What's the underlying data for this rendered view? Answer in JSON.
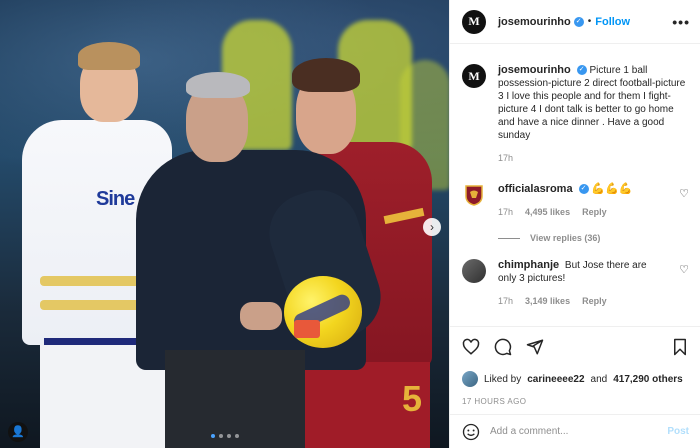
{
  "post": {
    "author": "josemourinho",
    "avatar_letter": "M",
    "follow_label": "Follow",
    "dot": "•",
    "more": "•••",
    "caption": "Picture 1 ball possession-picture 2 direct football-picture 3 I love this people and for them I fight-picture 4 I dont talk is better to go home and have a nice dinner . Have a good sunday",
    "caption_time": "17h",
    "photo": {
      "sponsor_text": "Sine",
      "shirt_number": "5",
      "next_arrow": "›",
      "tag_icon": "👤"
    }
  },
  "comments": [
    {
      "user": "officialasroma",
      "verified": true,
      "text": "💪💪💪",
      "time": "17h",
      "likes": "4,495 likes",
      "reply_label": "Reply",
      "view_replies": "View replies (36)"
    },
    {
      "user": "chimphanje",
      "verified": false,
      "text": "But Jose there are only 3 pictures!",
      "time": "17h",
      "likes": "3,149 likes",
      "reply_label": "Reply"
    }
  ],
  "engagement": {
    "liked_by_prefix": "Liked by",
    "liked_by_user": "carineeee22",
    "liked_by_and": "and",
    "liked_by_count": "417,290 others",
    "time_ago": "17 HOURS AGO"
  },
  "composer": {
    "placeholder": "Add a comment...",
    "post_label": "Post"
  },
  "icons": [
    "heart-icon",
    "comment-icon",
    "share-icon",
    "bookmark-icon",
    "emoji-icon",
    "more-icon",
    "verified-icon",
    "next-icon",
    "tag-icon"
  ],
  "colors": {
    "accent": "#0095f6",
    "verified": "#3897f0",
    "muted": "#8e8e8e",
    "post_disabled": "#b2dffc"
  }
}
